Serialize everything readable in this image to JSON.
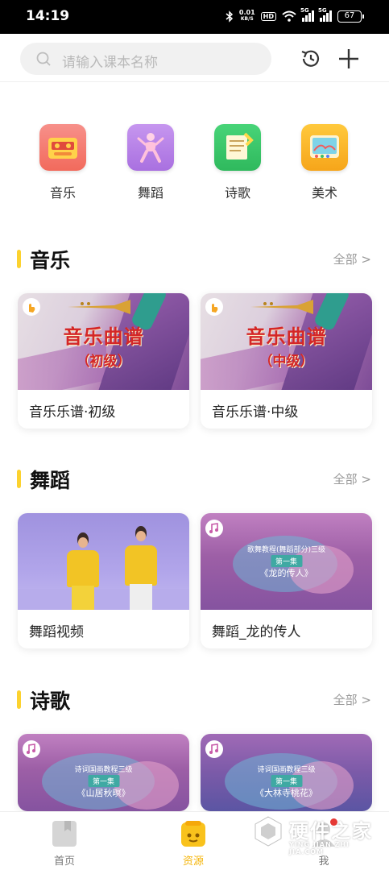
{
  "status_bar": {
    "time": "14:19",
    "net_speed_value": "0.01",
    "net_speed_unit": "KB/S",
    "hd_label": "HD",
    "signal1_label": "5G",
    "signal2_label": "5G",
    "battery": "67"
  },
  "search": {
    "placeholder": "请输入课本名称"
  },
  "categories": [
    {
      "label": "音乐",
      "icon": "radio-cassette-icon",
      "color": "#f47d6e"
    },
    {
      "label": "舞蹈",
      "icon": "dancer-icon",
      "color": "#b07ce6"
    },
    {
      "label": "诗歌",
      "icon": "scroll-icon",
      "color": "#39c96b"
    },
    {
      "label": "美术",
      "icon": "palette-icon",
      "color": "#fbb72a"
    }
  ],
  "sections": [
    {
      "title": "音乐",
      "more": "全部 >",
      "cards": [
        {
          "title": "音乐乐谱·初级",
          "thumb_title": "音乐曲谱",
          "thumb_sub": "（初级）"
        },
        {
          "title": "音乐乐谱·中级",
          "thumb_title": "音乐曲谱",
          "thumb_sub": "（中级）"
        }
      ]
    },
    {
      "title": "舞蹈",
      "more": "全部 >",
      "cards": [
        {
          "title": "舞蹈视频"
        },
        {
          "title": "舞蹈_龙的传人",
          "thumb_line1": "歌舞教程(舞蹈部分)三级",
          "thumb_band": "第一集",
          "thumb_name": "《龙的传人》"
        }
      ]
    },
    {
      "title": "诗歌",
      "more": "全部 >",
      "cards": [
        {
          "thumb_line1": "诗词国画教程三级",
          "thumb_band": "第一集",
          "thumb_name": "《山居秋暝》"
        },
        {
          "thumb_line1": "诗词国画教程三级",
          "thumb_band": "第一集",
          "thumb_name": "《大林寺桃花》"
        }
      ]
    }
  ],
  "tabbar": {
    "items": [
      {
        "label": "首页",
        "icon": "book-icon",
        "active": false
      },
      {
        "label": "资源",
        "icon": "resource-icon",
        "active": true
      },
      {
        "label": "我",
        "icon": "profile-icon",
        "active": false
      }
    ],
    "active_color": "#f5b50a",
    "inactive_color": "#777777"
  },
  "watermark": {
    "title": "硬件之家",
    "subtitle": "YING JIAN ZHI JIA.COM"
  },
  "colors": {
    "accent": "#fcd22f",
    "muted": "#999999"
  }
}
